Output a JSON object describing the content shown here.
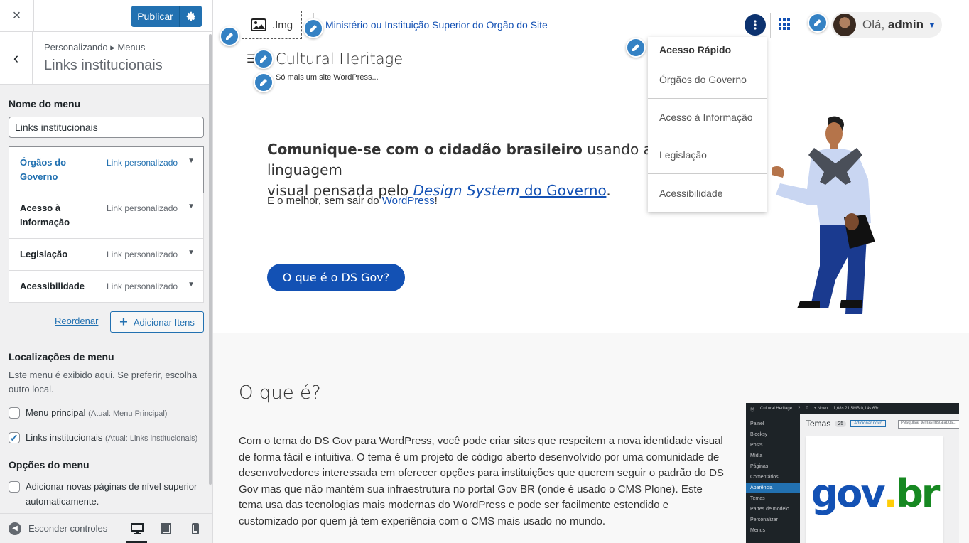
{
  "customizer": {
    "close_label": "×",
    "publish_label": "Publicar",
    "breadcrumb": "Personalizando ▸ Menus",
    "title": "Links institucionais",
    "menu_name_label": "Nome do menu",
    "menu_name_value": "Links institucionais",
    "items": [
      {
        "title": "Órgãos do Governo",
        "type": "Link personalizado"
      },
      {
        "title": "Acesso à Informação",
        "type": "Link personalizado"
      },
      {
        "title": "Legislação",
        "type": "Link personalizado"
      },
      {
        "title": "Acessibilidade",
        "type": "Link personalizado"
      }
    ],
    "reorder_label": "Reordenar",
    "add_items_label": "Adicionar Itens",
    "locations_title": "Localizações de menu",
    "locations_desc": "Este menu é exibido aqui. Se preferir, escolha outro local.",
    "locations": [
      {
        "label": "Menu principal",
        "sub": "(Atual: Menu Principal)",
        "checked": false
      },
      {
        "label": "Links institucionais",
        "sub": "(Atual: Links institucionais)",
        "checked": true
      }
    ],
    "options_title": "Opções do menu",
    "auto_add_label": "Adicionar novas páginas de nível superior automaticamente.",
    "hide_controls_label": "Esconder controles"
  },
  "header": {
    "logo_text": ".Img",
    "institution_link": "Ministério ou Instituição Superior do Orgão do Site",
    "site_title": "Cultural Heritage",
    "site_tagline": "Só mais um site WordPress...",
    "greeting": "Olá,",
    "username": "admin"
  },
  "quick_access": {
    "heading": "Acesso Rápido",
    "items": [
      "Órgãos do Governo",
      "Acesso à Informação",
      "Legislação",
      "Acessibilidade"
    ]
  },
  "hero": {
    "heading_bold": "Comunique-se com o cidadão brasileiro",
    "heading_rest": " usando a linguagem",
    "heading_line2_pre": "visual pensada pelo ",
    "heading_link": "Design System",
    "heading_link2": " do Governo",
    "heading_end": ".",
    "para_pre": "E o melhor, sem sair do ",
    "para_link": "WordPress",
    "para_end": "!",
    "button": "O que é o DS Gov?"
  },
  "about": {
    "title": "O que é?",
    "text": "Com o tema do DS Gov para WordPress, você pode criar sites que respeitem a nova identidade visual de forma fácil e intuitiva. O tema é um projeto de código aberto desenvolvido por uma comunidade de desenvolvedores interessada em oferecer opções para instituições que querem seguir o padrão do DS Gov mas que não mantém sua infraestrutura no portal Gov BR (onde é usado o CMS Plone). Este tema usa das tecnologias mais modernas do WordPress e pode ser facilmente estendido e customizado por quem já tem experiência com o CMS mais usado no mundo."
  },
  "screenshot": {
    "bar_items": [
      "Cultural Heritage",
      "2",
      "0",
      "+ Novo",
      "1,68s 21,5MB 0,14s 63q"
    ],
    "menu": [
      "Painel",
      "Blocksy",
      "Posts",
      "Mídia",
      "Páginas",
      "Comentários",
      "Aparência",
      "Temas",
      "Partes de modelo",
      "Personalizar",
      "Menus"
    ],
    "current": "Aparência",
    "title": "Temas",
    "count": "25",
    "add_new": "Adicionar novo",
    "search_placeholder": "Pesquisar temas instalados...",
    "logo": {
      "a": "gov",
      "b": ".",
      "c": "br"
    }
  },
  "colors": {
    "wp_blue": "#2271b1",
    "govbr_blue": "#1351b4",
    "govbr_dark": "#0c326f"
  }
}
